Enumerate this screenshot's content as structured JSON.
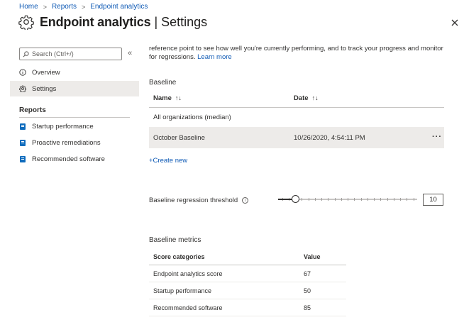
{
  "breadcrumb": [
    "Home",
    "Reports",
    "Endpoint analytics"
  ],
  "header": {
    "title": "Endpoint analytics",
    "separator": "|",
    "subtitle": "Settings"
  },
  "sidebar": {
    "search_placeholder": "Search (Ctrl+/)",
    "collapse": "«",
    "items": [
      {
        "label": "Overview",
        "icon": "info-circle-icon"
      },
      {
        "label": "Settings",
        "icon": "gear-icon",
        "active": true
      }
    ],
    "reports_label": "Reports",
    "reports": [
      {
        "label": "Startup performance",
        "icon": "report-icon"
      },
      {
        "label": "Proactive remediations",
        "icon": "report-icon"
      },
      {
        "label": "Recommended software",
        "icon": "report-icon"
      }
    ]
  },
  "intro": {
    "line1": "reference point to see how well you're currently performing, and to track your progress and monitor",
    "line2": "for regressions.",
    "link": "Learn more"
  },
  "baseline": {
    "heading": "Baseline",
    "columns": [
      "Name",
      "Date"
    ],
    "sort_glyph": "↑↓",
    "rows": [
      {
        "name": "All organizations (median)",
        "date": ""
      },
      {
        "name": "October Baseline",
        "date": "10/26/2020, 4:54:11 PM",
        "more": "···"
      }
    ],
    "create_new": "+Create new"
  },
  "threshold": {
    "label": "Baseline regression threshold",
    "info": "i",
    "value": "10",
    "slider_fraction": 0.1
  },
  "metrics": {
    "heading": "Baseline metrics",
    "columns": [
      "Score categories",
      "Value"
    ],
    "rows": [
      [
        "Endpoint analytics score",
        "67"
      ],
      [
        "Startup performance",
        "50"
      ],
      [
        "Recommended software",
        "85"
      ]
    ]
  },
  "colors": {
    "link": "#0f5ab5",
    "accent": "#0f6cbd",
    "selected_row": "#edebe9"
  }
}
